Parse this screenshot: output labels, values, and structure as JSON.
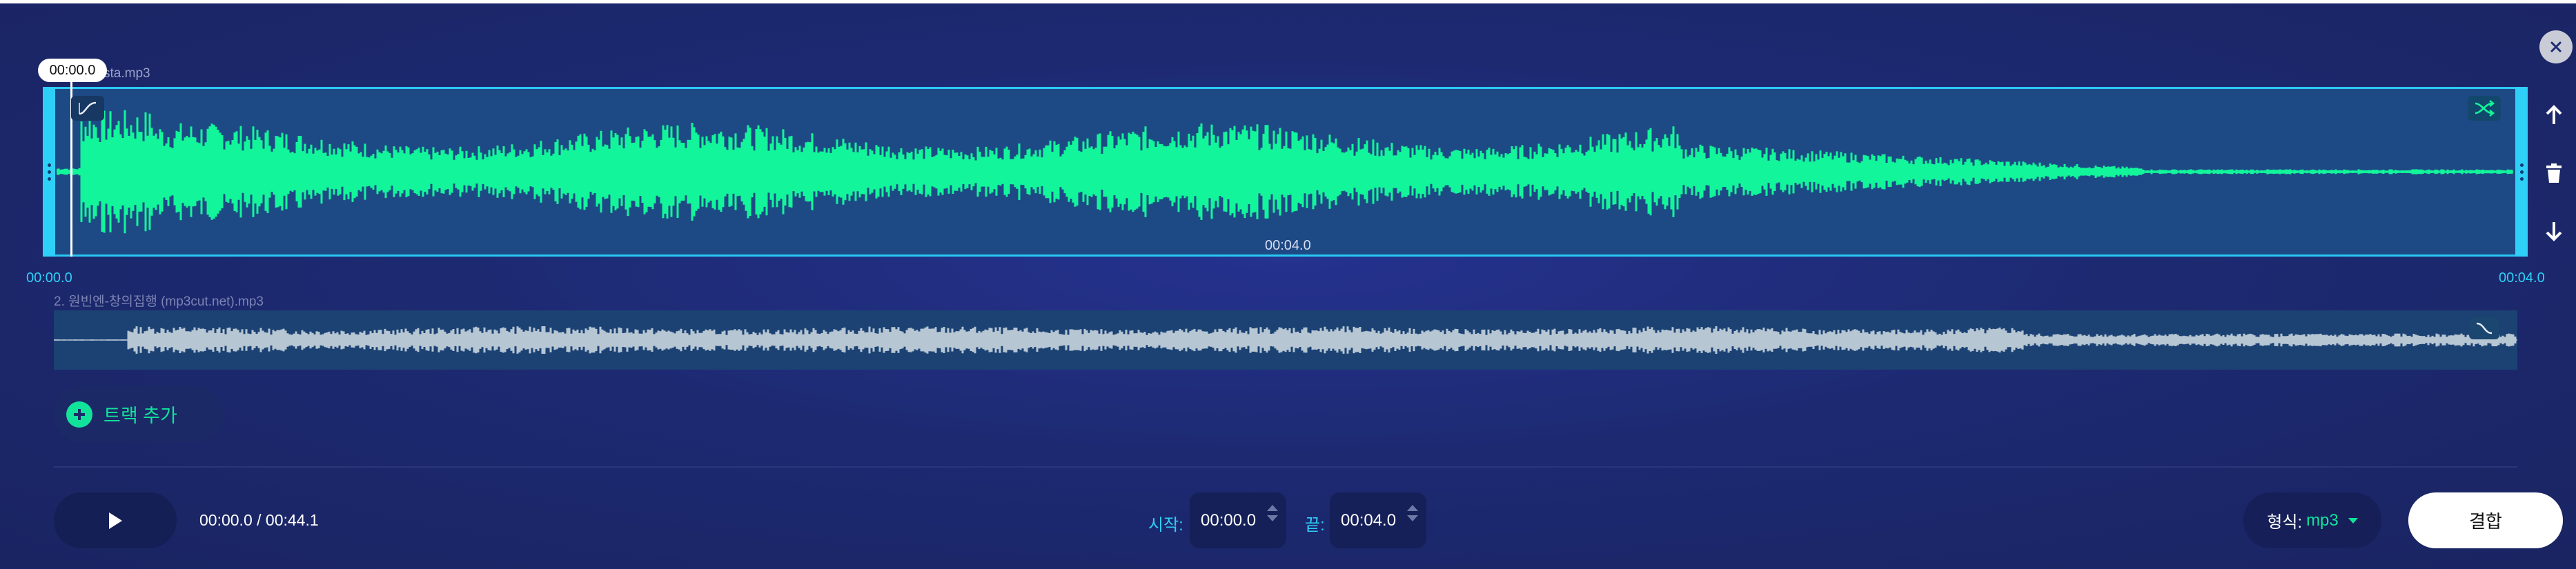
{
  "playhead": {
    "time": "00:00.0"
  },
  "tracks": [
    {
      "name": "sta.mp3",
      "mid_time": "00:04.0",
      "range_start": "00:00.0",
      "range_end": "00:04.0",
      "wave_color": "#12f59a",
      "selected": true
    },
    {
      "name": "2. 원빈엔-창의집행 (mp3cut.net).mp3",
      "wave_color": "#b7c6d3",
      "selected": false
    }
  ],
  "add_track": {
    "label": "트랙 추가"
  },
  "player": {
    "time_readout": "00:00.0 / 00:44.1"
  },
  "trim": {
    "start_label": "시작:",
    "start_value": "00:00.0",
    "end_label": "끝:",
    "end_value": "00:04.0"
  },
  "output": {
    "format_label": "형식:",
    "format_value": "mp3",
    "join_label": "결합"
  },
  "colors": {
    "accent_cyan": "#2fd0f7",
    "accent_green": "#12e39b",
    "background": "#1d2a72"
  },
  "icons": {
    "close": "close-icon",
    "fade_in": "fade-in-icon",
    "fade_out": "fade-out-icon",
    "shuffle": "shuffle-icon",
    "move_up": "arrow-up-icon",
    "delete": "trash-icon",
    "move_down": "arrow-down-icon",
    "add": "plus-icon",
    "play": "play-icon"
  }
}
